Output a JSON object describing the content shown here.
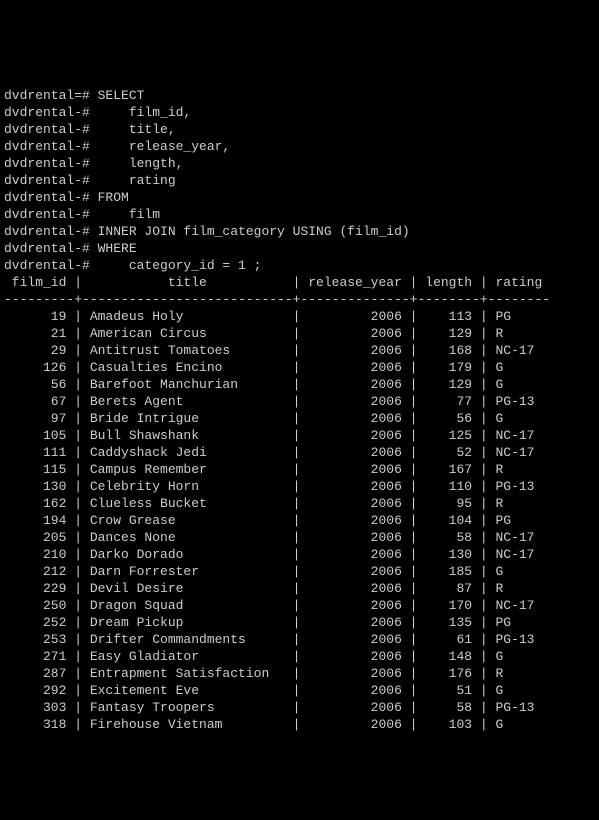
{
  "prompt_main": "dvdrental=#",
  "prompt_cont": "dvdrental-#",
  "query_lines": [
    "SELECT",
    "    film_id,",
    "    title,",
    "    release_year,",
    "    length,",
    "    rating",
    "FROM",
    "    film",
    "INNER JOIN film_category USING (film_id)",
    "WHERE",
    "    category_id = 1 ;"
  ],
  "columns": [
    {
      "name": "film_id",
      "width": 9,
      "align": "right"
    },
    {
      "name": "title",
      "width": 27,
      "align": "left"
    },
    {
      "name": "release_year",
      "width": 14,
      "align": "right"
    },
    {
      "name": "length",
      "width": 8,
      "align": "right"
    },
    {
      "name": "rating",
      "width": 8,
      "align": "left"
    }
  ],
  "chart_data": {
    "type": "table",
    "title": "",
    "rows": [
      {
        "film_id": 19,
        "title": "Amadeus Holy",
        "release_year": 2006,
        "length": 113,
        "rating": "PG"
      },
      {
        "film_id": 21,
        "title": "American Circus",
        "release_year": 2006,
        "length": 129,
        "rating": "R"
      },
      {
        "film_id": 29,
        "title": "Antitrust Tomatoes",
        "release_year": 2006,
        "length": 168,
        "rating": "NC-17"
      },
      {
        "film_id": 126,
        "title": "Casualties Encino",
        "release_year": 2006,
        "length": 179,
        "rating": "G"
      },
      {
        "film_id": 56,
        "title": "Barefoot Manchurian",
        "release_year": 2006,
        "length": 129,
        "rating": "G"
      },
      {
        "film_id": 67,
        "title": "Berets Agent",
        "release_year": 2006,
        "length": 77,
        "rating": "PG-13"
      },
      {
        "film_id": 97,
        "title": "Bride Intrigue",
        "release_year": 2006,
        "length": 56,
        "rating": "G"
      },
      {
        "film_id": 105,
        "title": "Bull Shawshank",
        "release_year": 2006,
        "length": 125,
        "rating": "NC-17"
      },
      {
        "film_id": 111,
        "title": "Caddyshack Jedi",
        "release_year": 2006,
        "length": 52,
        "rating": "NC-17"
      },
      {
        "film_id": 115,
        "title": "Campus Remember",
        "release_year": 2006,
        "length": 167,
        "rating": "R"
      },
      {
        "film_id": 130,
        "title": "Celebrity Horn",
        "release_year": 2006,
        "length": 110,
        "rating": "PG-13"
      },
      {
        "film_id": 162,
        "title": "Clueless Bucket",
        "release_year": 2006,
        "length": 95,
        "rating": "R"
      },
      {
        "film_id": 194,
        "title": "Crow Grease",
        "release_year": 2006,
        "length": 104,
        "rating": "PG"
      },
      {
        "film_id": 205,
        "title": "Dances None",
        "release_year": 2006,
        "length": 58,
        "rating": "NC-17"
      },
      {
        "film_id": 210,
        "title": "Darko Dorado",
        "release_year": 2006,
        "length": 130,
        "rating": "NC-17"
      },
      {
        "film_id": 212,
        "title": "Darn Forrester",
        "release_year": 2006,
        "length": 185,
        "rating": "G"
      },
      {
        "film_id": 229,
        "title": "Devil Desire",
        "release_year": 2006,
        "length": 87,
        "rating": "R"
      },
      {
        "film_id": 250,
        "title": "Dragon Squad",
        "release_year": 2006,
        "length": 170,
        "rating": "NC-17"
      },
      {
        "film_id": 252,
        "title": "Dream Pickup",
        "release_year": 2006,
        "length": 135,
        "rating": "PG"
      },
      {
        "film_id": 253,
        "title": "Drifter Commandments",
        "release_year": 2006,
        "length": 61,
        "rating": "PG-13"
      },
      {
        "film_id": 271,
        "title": "Easy Gladiator",
        "release_year": 2006,
        "length": 148,
        "rating": "G"
      },
      {
        "film_id": 287,
        "title": "Entrapment Satisfaction",
        "release_year": 2006,
        "length": 176,
        "rating": "R"
      },
      {
        "film_id": 292,
        "title": "Excitement Eve",
        "release_year": 2006,
        "length": 51,
        "rating": "G"
      },
      {
        "film_id": 303,
        "title": "Fantasy Troopers",
        "release_year": 2006,
        "length": 58,
        "rating": "PG-13"
      },
      {
        "film_id": 318,
        "title": "Firehouse Vietnam",
        "release_year": 2006,
        "length": 103,
        "rating": "G"
      }
    ]
  }
}
